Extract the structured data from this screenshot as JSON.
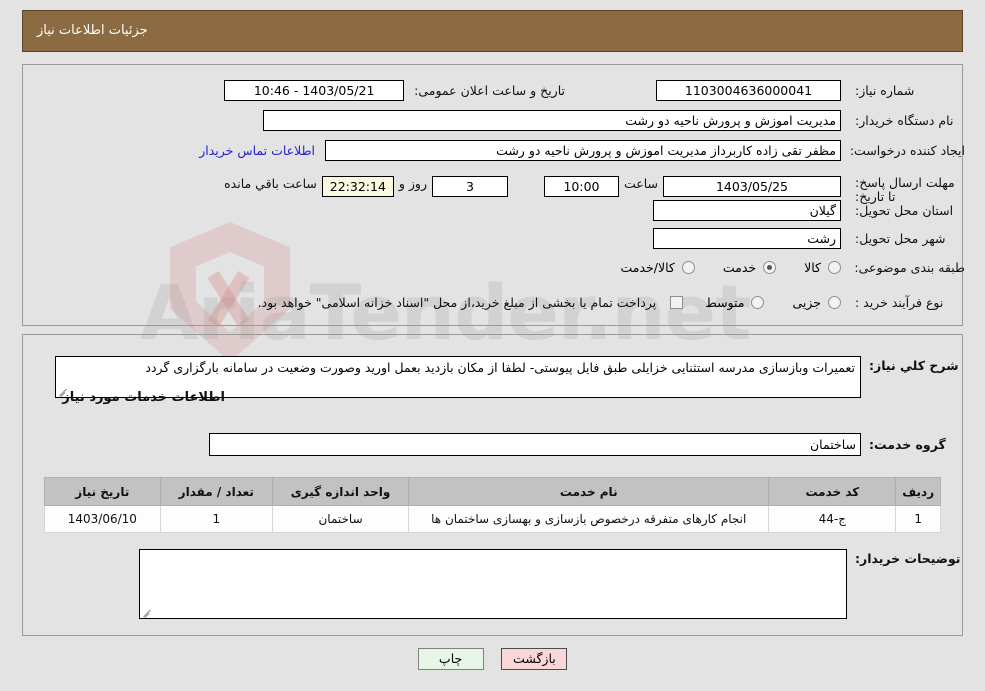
{
  "header": {
    "title": "جزئیات اطلاعات نیاز",
    "bar_color": "#8c6b43"
  },
  "watermark": {
    "text": "AriaTender.net"
  },
  "form": {
    "need_number": {
      "label": "شماره نیاز:",
      "value": "1103004636000041"
    },
    "public_announce": {
      "label": "تاریخ و ساعت اعلان عمومی:",
      "value": "1403/05/21 - 10:46"
    },
    "buyer_org": {
      "label": "نام دستگاه خریدار:",
      "value": "مدیریت اموزش و پرورش ناحیه دو رشت"
    },
    "requester": {
      "label": "ایجاد کننده درخواست:",
      "value": "مظفر  تقی زاده کاربرداز مدیریت اموزش و پرورش ناحیه دو رشت",
      "contact_link": "اطلاعات تماس خریدار"
    },
    "deadline": {
      "label": "مهلت ارسال پاسخ: تا تاریخ:",
      "date": "1403/05/25",
      "time_label": "ساعت",
      "time": "10:00",
      "days": "3",
      "days_label": "روز و",
      "countdown": "22:32:14",
      "remaining_label": "ساعت باقي مانده"
    },
    "province": {
      "label": "استان محل تحویل:",
      "value": "گیلان"
    },
    "city": {
      "label": "شهر محل تحویل:",
      "value": "رشت"
    },
    "category": {
      "label": "طبقه بندی موضوعی:",
      "options": [
        {
          "label": "کالا",
          "checked": false
        },
        {
          "label": "خدمت",
          "checked": true
        },
        {
          "label": "کالا/خدمت",
          "checked": false
        }
      ]
    },
    "purchase_type": {
      "label": "نوع فرآیند خرید :",
      "options": [
        {
          "label": "جزیی",
          "checked": false
        },
        {
          "label": "متوسط",
          "checked": false
        }
      ],
      "checkbox_note": "پرداخت تمام یا بخشی از مبلغ خرید،از محل \"اسناد خزانه اسلامی\" خواهد بود.",
      "checkbox_checked": false
    },
    "general_desc": {
      "label": "شرح کلي نیاز:",
      "value": "تعمیرات وبازسازی مدرسه استثنایی خزایلی طبق فایل پیوستی- لطفا از مکان بازدید بعمل اورید وصورت وضعیت در سامانه بارگزاری گردد"
    },
    "services_section_title": "اطلاعات خدمات مورد نیاز",
    "service_group": {
      "label": "گروه خدمت:",
      "value": "ساختمان"
    },
    "buyer_notes": {
      "label": "توضیحات خریدار:",
      "value": ""
    }
  },
  "table": {
    "columns": [
      "ردیف",
      "کد خدمت",
      "نام خدمت",
      "واحد اندازه گیری",
      "تعداد / مقدار",
      "تاریخ نیاز"
    ],
    "rows": [
      {
        "index": "1",
        "code": "ج-44",
        "name": "انجام کارهای متفرقه درخصوص بازسازی و بهسازی ساختمان ها",
        "unit": "ساختمان",
        "quantity": "1",
        "date": "1403/06/10"
      }
    ]
  },
  "buttons": {
    "back": "بازگشت",
    "print": "چاپ"
  }
}
